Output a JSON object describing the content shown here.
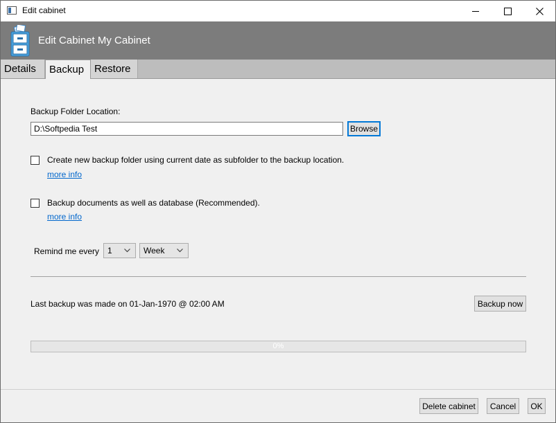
{
  "window": {
    "title": "Edit cabinet"
  },
  "header": {
    "title": "Edit Cabinet My Cabinet"
  },
  "tabs": [
    {
      "label": "Details"
    },
    {
      "label": "Backup"
    },
    {
      "label": "Restore"
    }
  ],
  "backup": {
    "folder_label": "Backup Folder Location:",
    "folder_value": "D:\\Softpedia Test",
    "browse_label": "Browse",
    "option1_label": "Create new backup folder using current date as subfolder to the backup location.",
    "option1_checked": false,
    "option2_label": "Backup documents as well as database (Recommended).",
    "option2_checked": false,
    "more_info": "more info",
    "remind_label": "Remind me every",
    "remind_count": "1",
    "remind_unit": "Week",
    "last_backup": "Last backup was made on 01-Jan-1970 @ 02:00 AM",
    "backup_now_label": "Backup now",
    "progress_text": "0%",
    "progress_value": 0
  },
  "footer": {
    "delete_label": "Delete cabinet",
    "cancel_label": "Cancel",
    "ok_label": "OK"
  },
  "colors": {
    "header_bg": "#7c7c7c",
    "link": "#0066cc",
    "focus": "#0078d7"
  }
}
